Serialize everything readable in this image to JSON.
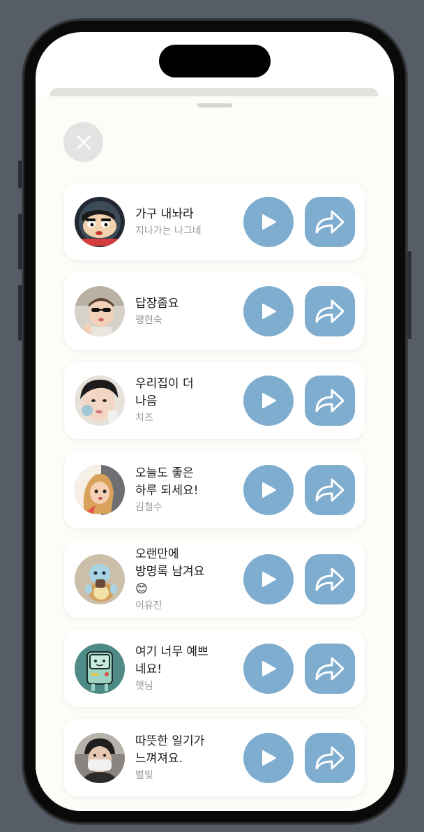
{
  "colors": {
    "accent": "#7fadcf",
    "sheet_bg": "#fdfcf7",
    "card_bg": "#ffffff",
    "author_text": "#9a9a9a"
  },
  "header": {
    "close_icon": "close-icon"
  },
  "messages": [
    {
      "title_lines": [
        "가구 내놔라"
      ],
      "author": "지나가는 나그네",
      "avatar": "crayon-shin-chan-avatar"
    },
    {
      "title_lines": [
        "답장좀요"
      ],
      "author": "팽현숙",
      "avatar": "baby-sunglasses-avatar"
    },
    {
      "title_lines": [
        "우리집이 더",
        "나음"
      ],
      "author": "치즈",
      "avatar": "child-photo-avatar"
    },
    {
      "title_lines": [
        "오늘도 좋은",
        "하루 되세요!"
      ],
      "author": "김철수",
      "avatar": "cartoon-girl-avatar"
    },
    {
      "title_lines": [
        "오랜만에",
        "방명록 남겨요",
        "😊"
      ],
      "author": "이유진",
      "avatar": "squirtle-avatar"
    },
    {
      "title_lines": [
        "여기 너무 예쁘",
        "네요!"
      ],
      "author": "햇님",
      "avatar": "bmo-avatar"
    },
    {
      "title_lines": [
        "따뜻한 일기가",
        "느껴져요."
      ],
      "author": "별빛",
      "avatar": "masked-person-avatar"
    }
  ]
}
